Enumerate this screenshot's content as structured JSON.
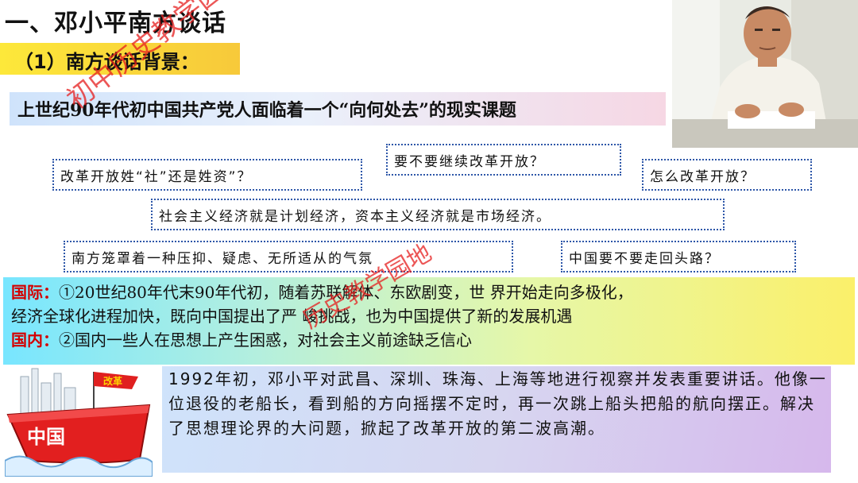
{
  "slide": {
    "title": "一、邓小平南方谈话",
    "subtitle": "（1）南方谈话背景：",
    "watermark_1": "初中历史教学园地",
    "watermark_2": "历史教学园地",
    "question_banner": "上世纪90年代初中国共产党人面临着一个“向何处去”的现实课题",
    "questions": [
      "改革开放姓“社”还是姓资”？",
      "要不要继续改革开放？",
      "怎么改革开放？",
      "社会主义经济就是计划经济，资本主义经济就是市场经济。",
      "南方笼罩着一种压抑、疑虑、无所适从的气氛",
      "中国要不要走回头路？"
    ],
    "context": {
      "intl_label": "国际：",
      "intl_line1": "①20世纪80年代末90年代初，随着苏联解体、东欧剧变，世 界开始走向多极化，",
      "intl_line2": "经济全球化进程加快，既向中国提出了严 峻挑战，也为中国提供了新的发展机遇",
      "dom_label": "国内：",
      "dom_text": "②国内一些人在思想上产生困惑，对社会主义前途缺乏信心"
    },
    "ship": {
      "flag_text": "改革",
      "hull_text": "中国"
    },
    "narrative": "1992年初，邓小平对武昌、深圳、珠海、上海等地进行视察并发表重要讲话。他像一位退役的老船长，看到船的方向摇摆不定时，再一次跳上船头把船的航向摆正。解决了思想理论界的大问题，掀起了改革开放的第二波高潮。"
  }
}
